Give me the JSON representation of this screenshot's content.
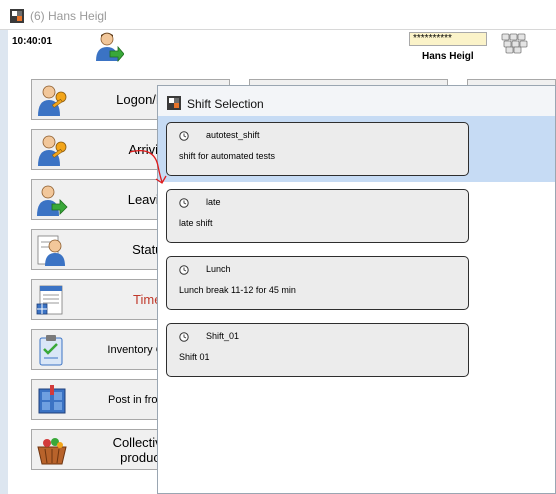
{
  "window": {
    "title": "(6) Hans Heigl"
  },
  "header": {
    "time": "10:40:01",
    "password_mask": "**********",
    "user_name": "Hans Heigl"
  },
  "buttons": [
    {
      "label": "Logon/Logo",
      "icon": "user-key-icon"
    },
    {
      "label": "Arriving",
      "icon": "user-key-icon"
    },
    {
      "label": "Leaving",
      "icon": "user-leave-icon"
    },
    {
      "label": "Status",
      "icon": "user-status-icon"
    },
    {
      "label": "Times",
      "icon": "times-sheet-icon"
    },
    {
      "label": "Inventory Countin",
      "icon": "clipboard-check-icon"
    },
    {
      "label": "Post in from Prod",
      "icon": "post-in-icon"
    },
    {
      "label": "Collective iss\nproduction",
      "icon": "basket-icon"
    }
  ],
  "dialog": {
    "title": "Shift Selection",
    "shifts": [
      {
        "name": "autotest_shift",
        "description": "shift for automated tests"
      },
      {
        "name": "late",
        "description": "late shift"
      },
      {
        "name": "Lunch",
        "description": "Lunch break 11-12 for 45 min"
      },
      {
        "name": "Shift_01",
        "description": "Shift 01"
      }
    ]
  },
  "colors": {
    "highlight": "#c6dbf4",
    "times_label": "#c0392b",
    "annotation": "#e01b1b",
    "password_bg": "#fbf3c9"
  }
}
